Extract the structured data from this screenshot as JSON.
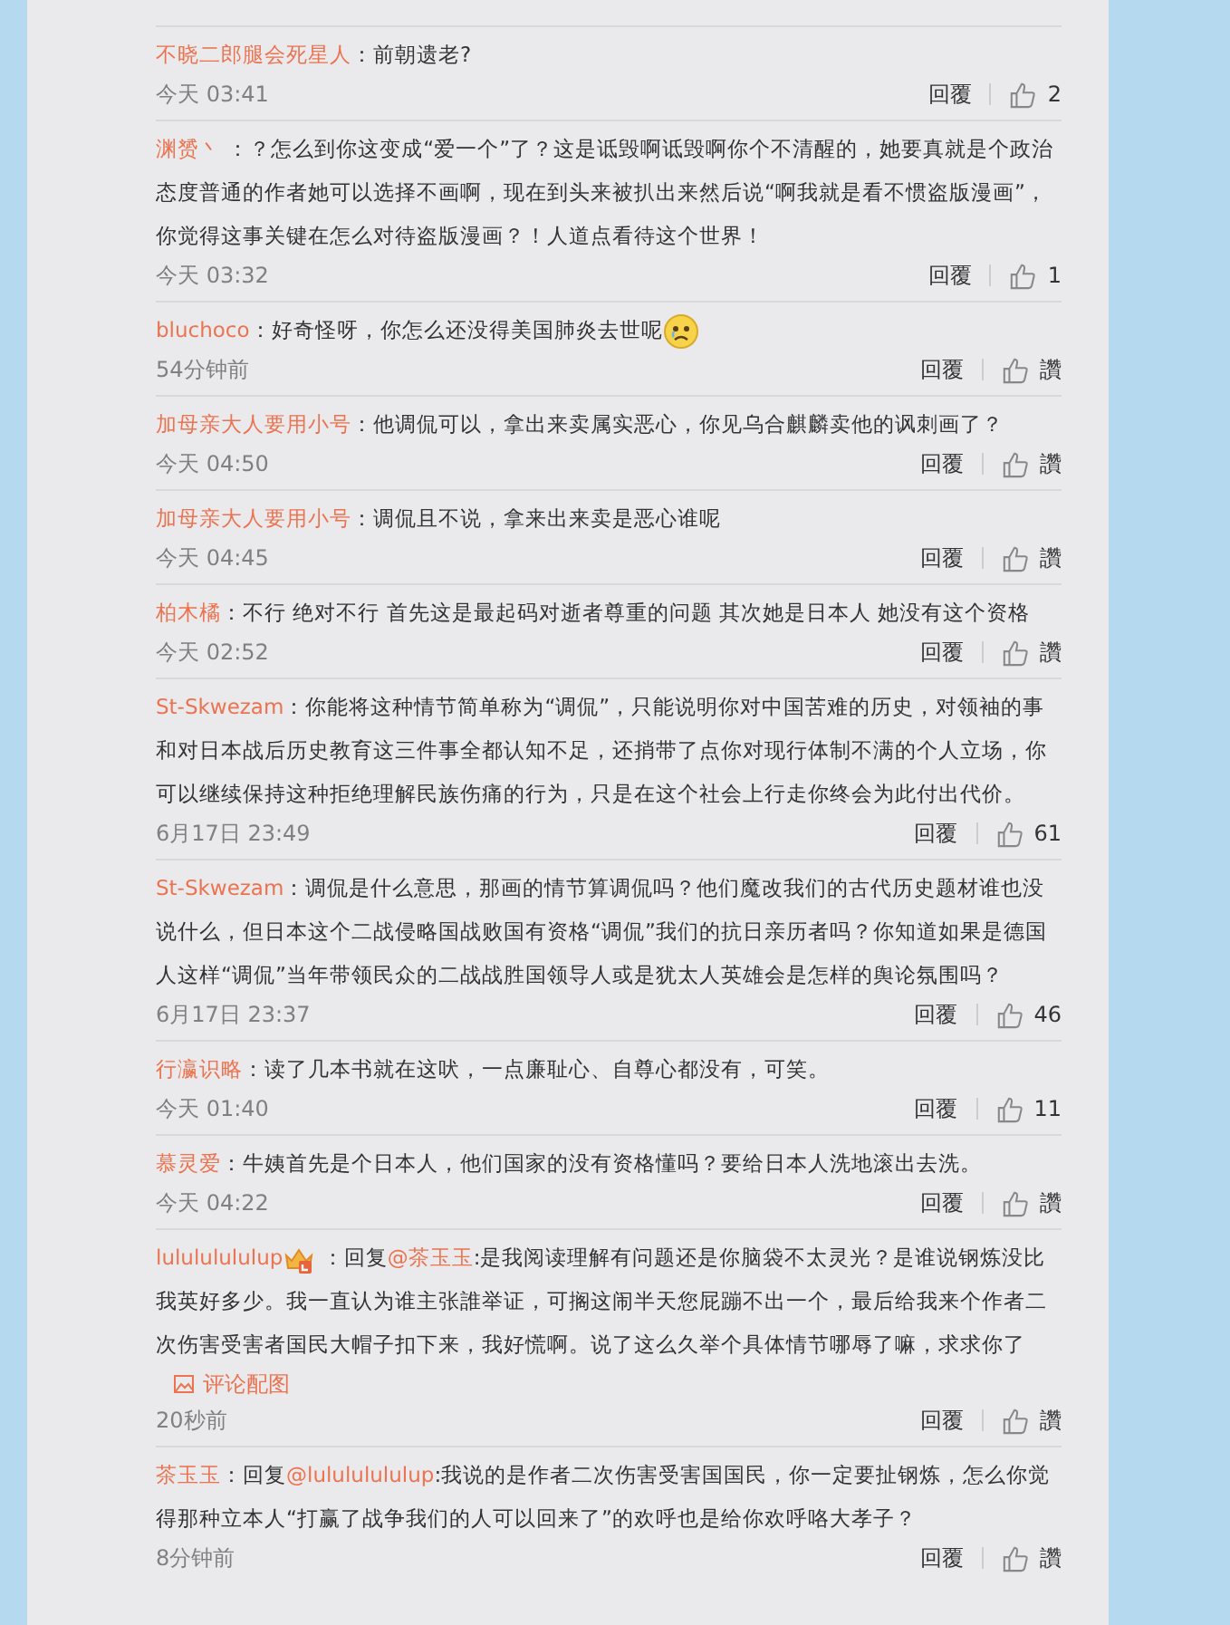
{
  "comments": [
    {
      "author": "不晓二郎腿会死星人",
      "text": "：前朝遗老?",
      "time": "今天 03:41",
      "reply": "回覆",
      "likes": "2"
    },
    {
      "author": "渊赟丶",
      "text": " ：？怎么到你这变成“爱一个”了？这是诋毁啊诋毁啊你个不清醒的，她要真就是个政治态度普通的作者她可以选择不画啊，现在到头来被扒出来然后说“啊我就是看不惯盗版漫画”，你觉得这事关键在怎么对待盗版漫画？！人道点看待这个世界！",
      "time": "今天 03:32",
      "reply": "回覆",
      "likes": "1"
    },
    {
      "author": "bluchoco",
      "text": "：好奇怪呀，你怎么还没得美国肺炎去世呢",
      "sad_emoticon": true,
      "time": "54分钟前",
      "reply": "回覆",
      "likes": "讚"
    },
    {
      "author": "加母亲大人要用小号",
      "text": "：他调侃可以，拿出来卖属实恶心，你见乌合麒麟卖他的讽刺画了？",
      "time": "今天 04:50",
      "reply": "回覆",
      "likes": "讚"
    },
    {
      "author": "加母亲大人要用小号",
      "text": "：调侃且不说，拿来出来卖是恶心谁呢",
      "time": "今天 04:45",
      "reply": "回覆",
      "likes": "讚"
    },
    {
      "author": "柏木橘",
      "text": "：不行 绝对不行  首先这是最起码对逝者尊重的问题 其次她是日本人 她没有这个资格",
      "time": "今天 02:52",
      "reply": "回覆",
      "likes": "讚"
    },
    {
      "author": "St-Skwezam",
      "text": "：你能将这种情节简单称为“调侃”，只能说明你对中国苦难的历史，对领袖的事和对日本战后历史教育这三件事全都认知不足，还捎带了点你对现行体制不满的个人立场，你可以继续保持这种拒绝理解民族伤痛的行为，只是在这个社会上行走你终会为此付出代价。",
      "time": "6月17日 23:49",
      "reply": "回覆",
      "likes": "61"
    },
    {
      "author": "St-Skwezam",
      "text": "：调侃是什么意思，那画的情节算调侃吗？他们魔改我们的古代历史题材谁也没说什么，但日本这个二战侵略国战败国有资格“调侃”我们的抗日亲历者吗？你知道如果是德国人这样“调侃”当年带领民众的二战战胜国领导人或是犹太人英雄会是怎样的舆论氛围吗？",
      "time": "6月17日 23:37",
      "reply": "回覆",
      "likes": "46"
    },
    {
      "author": "行瀛识略",
      "text": "：读了几本书就在这吠，一点廉耻心、自尊心都没有，可笑。",
      "time": "今天 01:40",
      "reply": "回覆",
      "likes": "11"
    },
    {
      "author": "慕灵爱",
      "text": "：牛姨首先是个日本人，他们国家的没有资格懂吗？要给日本人洗地滚出去洗。",
      "time": "今天 04:22",
      "reply": "回覆",
      "likes": "讚"
    },
    {
      "author": "lulululululup",
      "crown_badge": true,
      "prefix": " ：回复",
      "mention": "@茶玉玉",
      "text": ":是我阅读理解有问题还是你脑袋不太灵光？是谁说钢炼没比我英好多少。我一直认为谁主张誰举证，可搁这闹半天您屁蹦不出一个，最后给我来个作者二次伤害受害者国民大帽子扣下来，我好慌啊。说了这么久举个具体情节哪辱了嘛，求求你了",
      "attachment": "评论配图",
      "time": "20秒前",
      "reply": "回覆",
      "likes": "讚"
    },
    {
      "author": "茶玉玉",
      "prefix": "：回复",
      "mention": "@lulululululup",
      "text": ":我说的是作者二次伤害受害国国民，你一定要扯钢炼，怎么你觉得那种立本人“打赢了战争我们的人可以回来了”的欢呼也是给你欢呼咯大孝子？",
      "time": "8分钟前",
      "reply": "回覆",
      "likes": "讚"
    }
  ]
}
